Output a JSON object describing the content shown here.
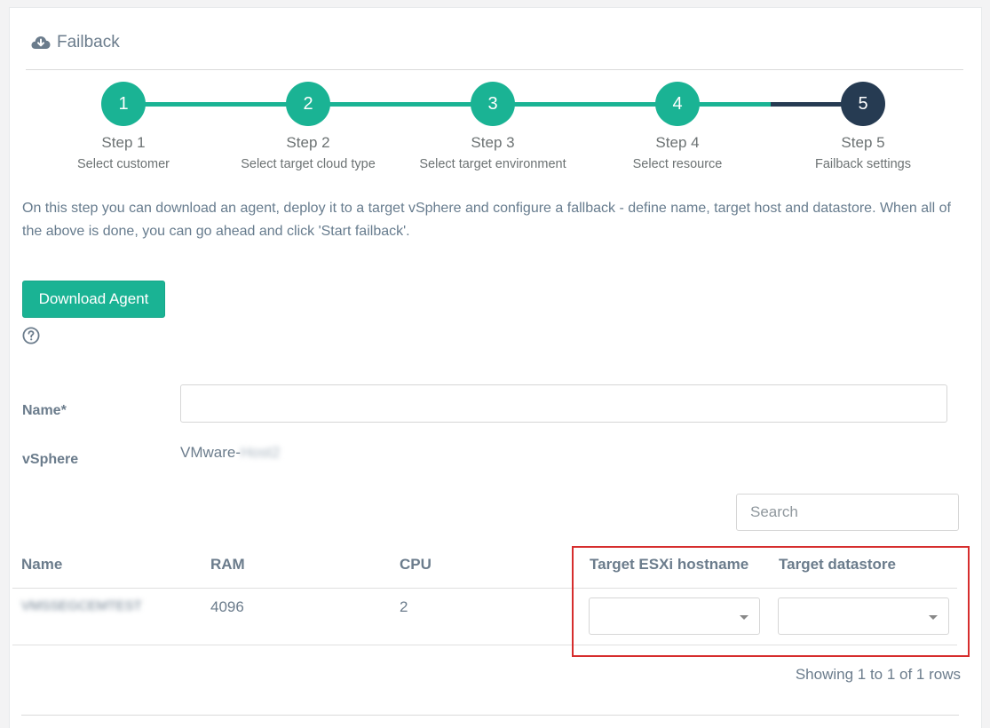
{
  "panel": {
    "title": "Failback",
    "icon": "cloud-download-icon"
  },
  "stepper": {
    "accent_color": "#1ab394",
    "active_color": "#263b52",
    "steps": [
      {
        "number": "1",
        "title": "Step 1",
        "subtitle": "Select customer",
        "state": "done"
      },
      {
        "number": "2",
        "title": "Step 2",
        "subtitle": "Select target cloud type",
        "state": "done"
      },
      {
        "number": "3",
        "title": "Step 3",
        "subtitle": "Select target environment",
        "state": "done"
      },
      {
        "number": "4",
        "title": "Step 4",
        "subtitle": "Select resource",
        "state": "done"
      },
      {
        "number": "5",
        "title": "Step 5",
        "subtitle": "Failback settings",
        "state": "active"
      }
    ]
  },
  "description": "On this step you can download an agent, deploy it to a target vSphere and configure a fallback - define name, target host and datastore. When all of the above is done, you can go ahead and click 'Start failback'.",
  "download_button": "Download Agent",
  "help_icon": "question-circle-icon",
  "form": {
    "name_label": "Name*",
    "name_value": "",
    "vsphere_label": "vSphere",
    "vsphere_value_prefix": "VMware-",
    "vsphere_value_redacted": "Host2"
  },
  "search": {
    "placeholder": "Search",
    "value": ""
  },
  "table": {
    "columns": [
      "Name",
      "RAM",
      "CPU",
      "Target ESXi hostname",
      "Target datastore"
    ],
    "rows": [
      {
        "name": "VMSSEGCEMTEST",
        "ram": "4096",
        "cpu": "2",
        "target_esxi": "",
        "target_datastore": ""
      }
    ]
  },
  "pagination_info": "Showing 1 to 1 of 1 rows",
  "highlight_color": "#d62d2d"
}
